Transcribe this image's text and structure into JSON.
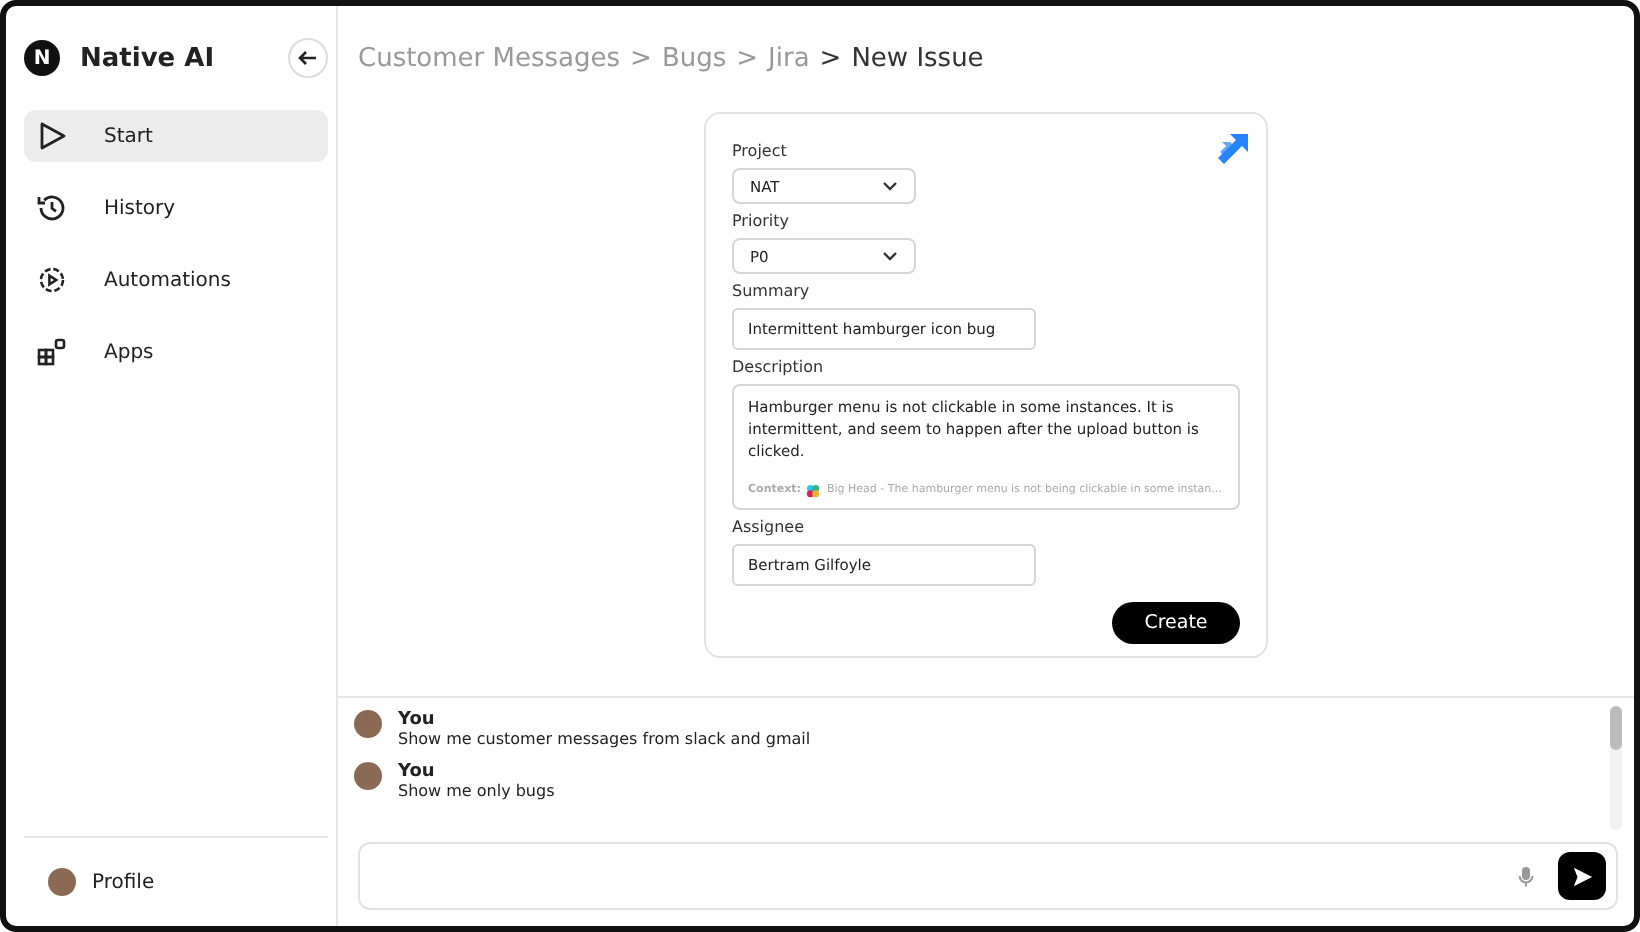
{
  "sidebar": {
    "brand": "Native AI",
    "logo_letter": "N",
    "items": [
      {
        "label": "Start",
        "kind": "play",
        "selected": true
      },
      {
        "label": "History",
        "kind": "history",
        "selected": false
      },
      {
        "label": "Automations",
        "kind": "gear",
        "selected": false
      },
      {
        "label": "Apps",
        "kind": "apps",
        "selected": false
      }
    ],
    "profile": "Profile"
  },
  "breadcrumb": {
    "separator": ">",
    "items": [
      {
        "label": "Customer Messages",
        "selected": false
      },
      {
        "label": "Bugs",
        "selected": false
      },
      {
        "label": "Jira",
        "selected": false
      },
      {
        "label": "New Issue",
        "selected": true
      }
    ]
  },
  "form": {
    "fields": [
      {
        "kind": "select",
        "label": "Project",
        "value": "NAT"
      },
      {
        "kind": "select",
        "label": "Priority",
        "value": "P0"
      },
      {
        "kind": "text",
        "label": "Summary",
        "value": "Intermittent hamburger icon bug"
      },
      {
        "kind": "textarea",
        "label": "Description",
        "value": "Hamburger menu is not clickable in some instances. It is intermittent, and seem to happen after the upload button is clicked.",
        "context_label": "Context:",
        "context": "Big Head - The hamburger menu is not being clickable in some instan..."
      },
      {
        "kind": "text",
        "label": "Assignee",
        "value": "Bertram Gilfoyle"
      }
    ],
    "submit": "Create"
  },
  "chat": {
    "messages": [
      {
        "author": "You",
        "text": "Show me customer messages from slack and gmail"
      },
      {
        "author": "You",
        "text": "Show me only bugs"
      }
    ]
  }
}
